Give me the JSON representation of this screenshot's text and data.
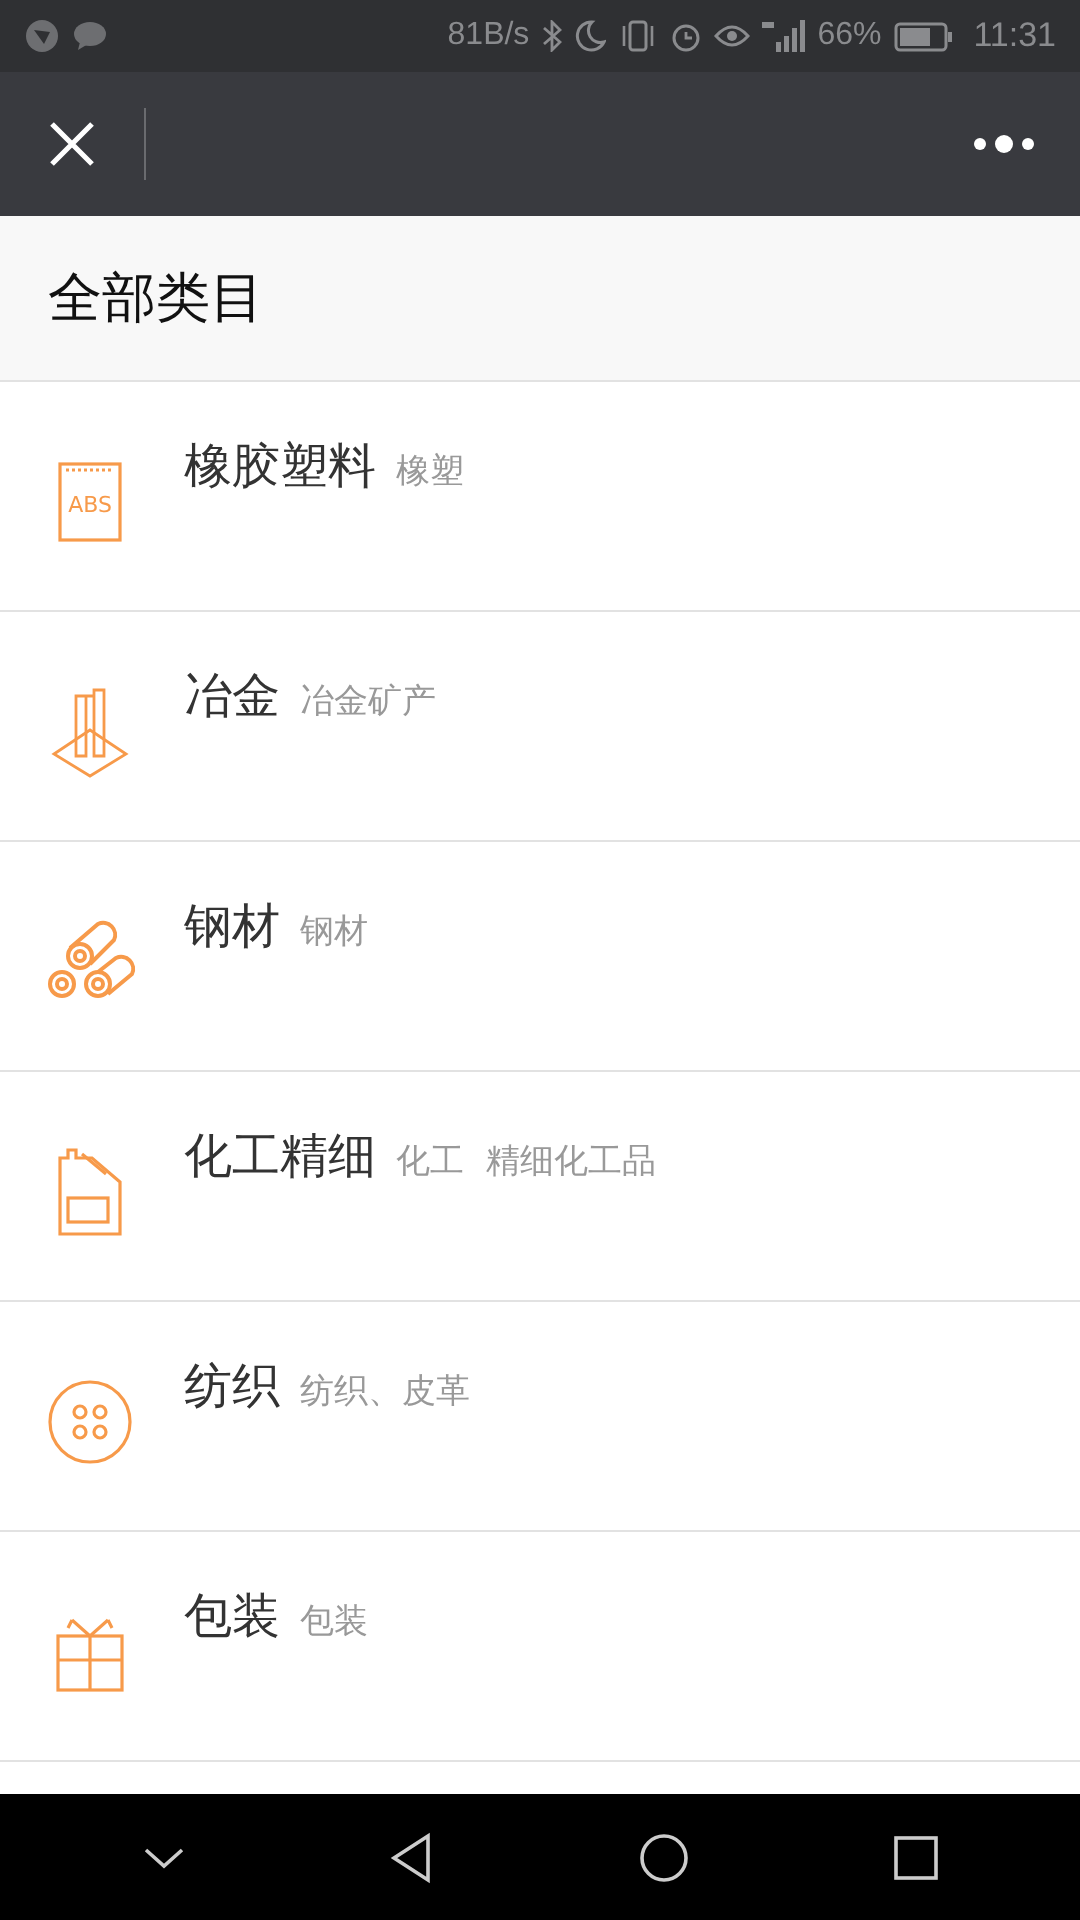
{
  "status_bar": {
    "speed": "81B/s",
    "battery": "66%",
    "time": "11:31"
  },
  "header": {
    "title": "全部类目"
  },
  "categories": [
    {
      "kind": "abs",
      "icon_text": "ABS",
      "name": "橡胶塑料",
      "desc": "橡塑"
    },
    {
      "kind": "beam",
      "name": "冶金",
      "desc": "冶金矿产"
    },
    {
      "kind": "pipes",
      "name": "钢材",
      "desc": "钢材"
    },
    {
      "kind": "canister",
      "name": "化工精细",
      "desc": "化工  精细化工品"
    },
    {
      "kind": "button",
      "name": "纺织",
      "desc": "纺织、皮革"
    },
    {
      "kind": "gift",
      "name": "包装",
      "desc": "包装"
    }
  ]
}
